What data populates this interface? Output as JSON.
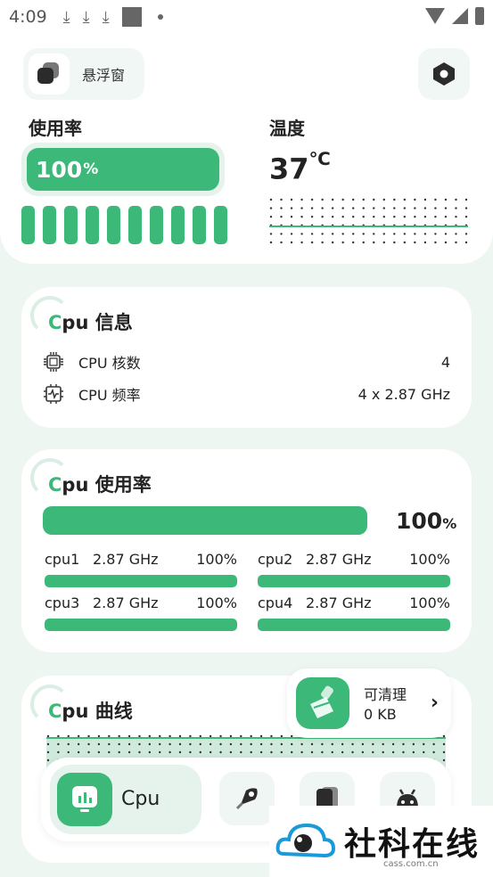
{
  "status_bar": {
    "time": "4:09",
    "download_icon": "download-icon"
  },
  "header": {
    "float_window_label": "悬浮窗",
    "settings_icon": "hexagon-settings-icon"
  },
  "usage": {
    "title": "使用率",
    "percent_value": "100",
    "percent_unit": "%",
    "level": 1.0,
    "bar_count": 10
  },
  "temperature": {
    "title": "温度",
    "value": "37",
    "unit": "℃"
  },
  "cpu_info": {
    "title_c": "C",
    "title_rest": "pu 信息",
    "rows": [
      {
        "label": "CPU 核数",
        "value": "4"
      },
      {
        "label": "CPU 频率",
        "value": "4 x 2.87 GHz"
      }
    ]
  },
  "cpu_usage": {
    "title_c": "C",
    "title_rest": "pu 使用率",
    "total_value": "100",
    "total_unit": "%",
    "total_level": 1.0,
    "cores": [
      {
        "name": "cpu1",
        "freq": "2.87 GHz",
        "pct": "100%",
        "level": 1.0
      },
      {
        "name": "cpu2",
        "freq": "2.87 GHz",
        "pct": "100%",
        "level": 1.0
      },
      {
        "name": "cpu3",
        "freq": "2.87 GHz",
        "pct": "100%",
        "level": 1.0
      },
      {
        "name": "cpu4",
        "freq": "2.87 GHz",
        "pct": "100%",
        "level": 1.0
      }
    ]
  },
  "cpu_curve": {
    "title_c": "C",
    "title_rest": "pu 曲线"
  },
  "clean": {
    "label": "可清理",
    "size": "0 KB",
    "icon": "broom-icon"
  },
  "nav": {
    "active_label": "Cpu",
    "items": [
      "rocket-icon",
      "battery-icon",
      "android-icon"
    ]
  },
  "watermark": {
    "text": "社科在线",
    "sub": "cass.com.cn"
  },
  "colors": {
    "accent": "#3cb878",
    "accent_light": "#e5f3ec",
    "background": "#eef6f2"
  }
}
